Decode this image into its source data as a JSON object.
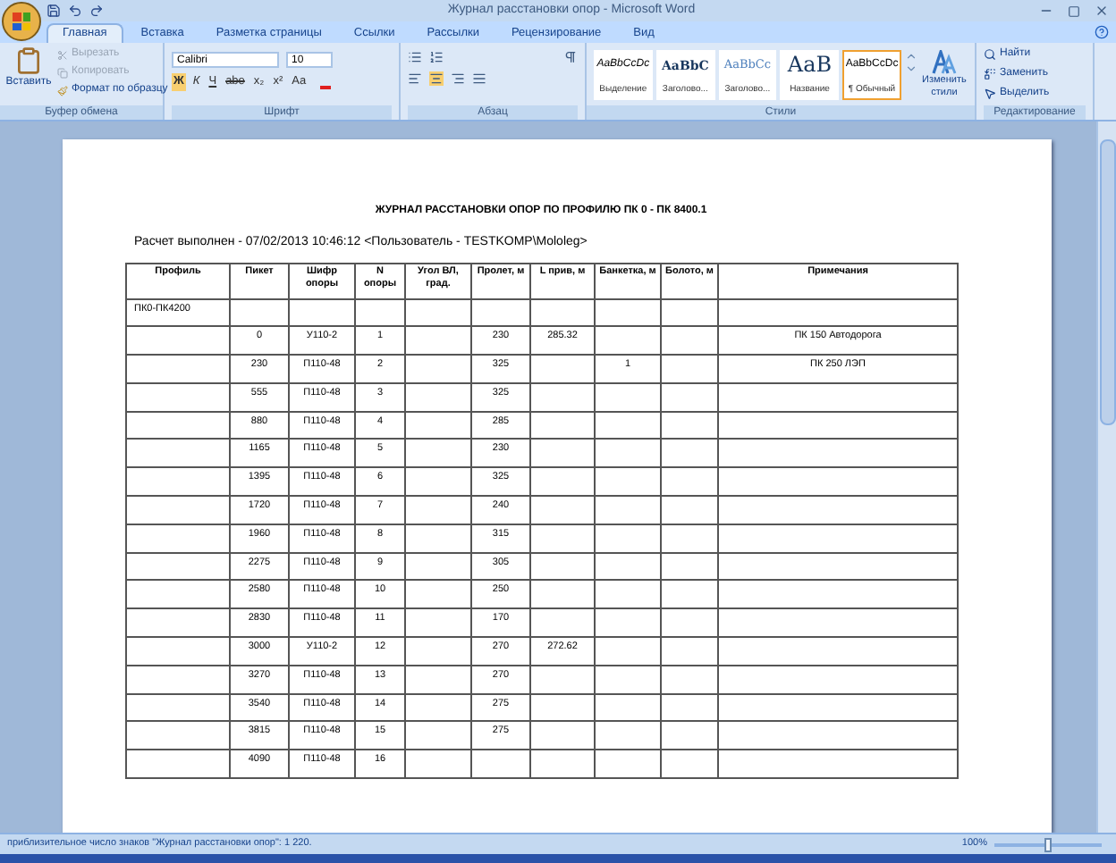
{
  "window": {
    "title": "Журнал расстановки опор - Microsoft Word"
  },
  "tabs": [
    {
      "label": "Главная",
      "selected": true
    },
    {
      "label": "Вставка",
      "selected": false
    },
    {
      "label": "Разметка страницы",
      "selected": false
    },
    {
      "label": "Ссылки",
      "selected": false
    },
    {
      "label": "Рассылки",
      "selected": false
    },
    {
      "label": "Рецензирование",
      "selected": false
    },
    {
      "label": "Вид",
      "selected": false
    }
  ],
  "clipboard": {
    "paste": "Вставить",
    "cut": "Вырезать",
    "copy": "Копировать",
    "format_painter": "Формат по образцу",
    "group_label": "Буфер обмена"
  },
  "font": {
    "name": "Calibri",
    "size": "10",
    "format_buttons": [
      "Ж",
      "К",
      "Ч",
      "abe",
      "x₂",
      "x²",
      "Aa"
    ],
    "group_label": "Шрифт"
  },
  "paragraph": {
    "group_label": "Абзац"
  },
  "styles": {
    "items": [
      {
        "sample": "AaBbCcDc",
        "label": "Выделение",
        "kind": "italic",
        "selected": false
      },
      {
        "sample": "AaBbC",
        "label": "Заголово...",
        "kind": "heading",
        "selected": false
      },
      {
        "sample": "AaBbCc",
        "label": "Заголово...",
        "kind": "heading2",
        "selected": false
      },
      {
        "sample": "AaB",
        "label": "Название",
        "kind": "title",
        "selected": false
      },
      {
        "sample": "AaBbCcDc",
        "label": "¶ Обычный",
        "kind": "normal",
        "selected": true
      }
    ],
    "change_styles": "Изменить стили",
    "group_label": "Стили"
  },
  "editing": {
    "find": "Найти",
    "replace": "Заменить",
    "select": "Выделить",
    "group_label": "Редактирование"
  },
  "document": {
    "heading": "ЖУРНАЛ РАССТАНОВКИ  ОПОР ПО ПРОФИЛЮ ПК 0 - ПК 8400.1",
    "subtitle": "Расчет выполнен - 07/02/2013 10:46:12  <Пользователь - TESTKOMP\\Mololeg>",
    "table": {
      "columns": [
        "Профиль",
        "Пикет",
        "Шифр опоры",
        "N опоры",
        "Угол ВЛ, град.",
        "Пролет, м",
        "L прив, м",
        "Банкетка, м",
        "Болото, м",
        "Примечания"
      ],
      "rows": [
        {
          "profile": "ПК0-ПК4200"
        },
        {
          "piket": "0",
          "code": "У110-2",
          "n": "1",
          "span": "230",
          "l": "285.32",
          "note": "ПК 150 Автодорога"
        },
        {
          "piket": "230",
          "code": "П110-48",
          "n": "2",
          "span": "325",
          "bank": "1",
          "note": "ПК 250 ЛЭП"
        },
        {
          "piket": "555",
          "code": "П110-48",
          "n": "3",
          "span": "325"
        },
        {
          "piket": "880",
          "code": "П110-48",
          "n": "4",
          "span": "285"
        },
        {
          "piket": "1165",
          "code": "П110-48",
          "n": "5",
          "span": "230"
        },
        {
          "piket": "1395",
          "code": "П110-48",
          "n": "6",
          "span": "325"
        },
        {
          "piket": "1720",
          "code": "П110-48",
          "n": "7",
          "span": "240"
        },
        {
          "piket": "1960",
          "code": "П110-48",
          "n": "8",
          "span": "315"
        },
        {
          "piket": "2275",
          "code": "П110-48",
          "n": "9",
          "span": "305"
        },
        {
          "piket": "2580",
          "code": "П110-48",
          "n": "10",
          "span": "250"
        },
        {
          "piket": "2830",
          "code": "П110-48",
          "n": "11",
          "span": "170"
        },
        {
          "piket": "3000",
          "code": "У110-2",
          "n": "12",
          "span": "270",
          "l": "272.62"
        },
        {
          "piket": "3270",
          "code": "П110-48",
          "n": "13",
          "span": "270"
        },
        {
          "piket": "3540",
          "code": "П110-48",
          "n": "14",
          "span": "275"
        },
        {
          "piket": "3815",
          "code": "П110-48",
          "n": "15",
          "span": "275"
        },
        {
          "piket": "4090",
          "code": "П110-48",
          "n": "16"
        }
      ]
    }
  },
  "status_bar": {
    "text": "приблизительное число знаков \"Журнал расстановки опор\": 1 220.",
    "zoom": "100%",
    "zoom_slider": {
      "level": 0.5
    }
  }
}
